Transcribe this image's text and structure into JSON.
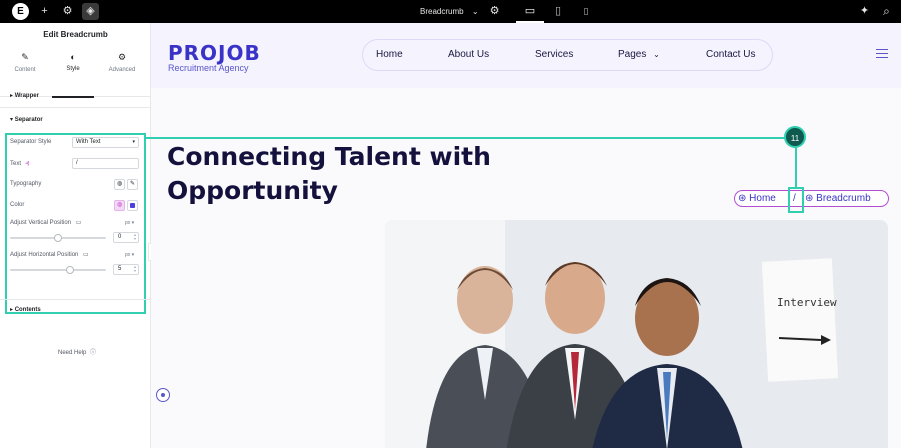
{
  "topbar": {
    "logo_glyph": "E",
    "add_icon": "+",
    "settings_icon": "⚙",
    "structure_icon": "◈",
    "document_title": "Breadcrumb",
    "document_chevron": "⌄",
    "document_settings_icon": "⚙",
    "device_desktop": "▭",
    "device_tablet": "▯",
    "device_mobile": "▯",
    "notification_icon": "✦",
    "search_icon": "⌕"
  },
  "panel": {
    "title": "Edit Breadcrumb",
    "tabs": [
      {
        "icon": "✎",
        "label": "Content"
      },
      {
        "icon": "◐",
        "label": "Style"
      },
      {
        "icon": "⚙",
        "label": "Advanced"
      }
    ],
    "wrapper_label": "Wrapper",
    "separator_label": "Separator",
    "separator_style_label": "Separator Style",
    "separator_style_value": "With Text",
    "text_label": "Text",
    "text_value": "/",
    "typography_label": "Typography",
    "color_label": "Color",
    "vertical_label": "Adjust Vertical Position",
    "vertical_unit": "px",
    "vertical_value": "0",
    "horizontal_label": "Adjust Horizontal Position",
    "horizontal_unit": "px",
    "horizontal_value": "5",
    "contents_label": "Contents",
    "need_help": "Need Help",
    "separator_color": "#4b3fe0"
  },
  "site": {
    "logo": "PROJOB",
    "logo_tagline": "Recruitment Agency",
    "nav": [
      "Home",
      "About Us",
      "Services",
      "Pages",
      "Contact Us"
    ],
    "headline_line1": "Connecting Talent with",
    "headline_line2": "Opportunity",
    "breadcrumb_home": "Home",
    "breadcrumb_separator": "/",
    "breadcrumb_current": "Breadcrumb",
    "photo_sign": "Interview",
    "accent_color": "#3a33c7"
  },
  "callout": {
    "number": "11"
  }
}
